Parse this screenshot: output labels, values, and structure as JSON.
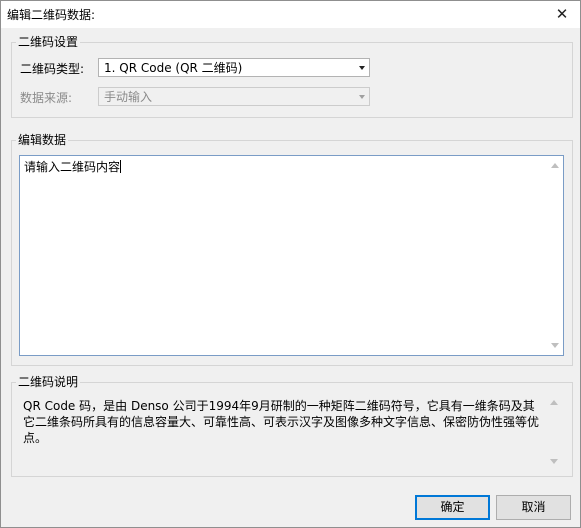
{
  "window": {
    "title": "编辑二维码数据:",
    "close_glyph": "✕"
  },
  "settings_group": {
    "label": "二维码设置",
    "type_label": "二维码类型:",
    "type_value": "1.  QR Code (QR 二维码)",
    "source_label": "数据来源:",
    "source_value": "手动输入"
  },
  "edit_group": {
    "label": "编辑数据",
    "content": "请输入二维码内容"
  },
  "description_group": {
    "label": "二维码说明",
    "text": "QR Code 码，是由 Denso 公司于1994年9月研制的一种矩阵二维码符号，它具有一维条码及其它二维条码所具有的信息容量大、可靠性高、可表示汉字及图像多种文字信息、保密防伪性强等优点。"
  },
  "buttons": {
    "ok_label": "确定",
    "cancel_label": "取消"
  },
  "icons": {
    "combo_arrow": "chevron-down-icon",
    "close": "close-icon"
  }
}
